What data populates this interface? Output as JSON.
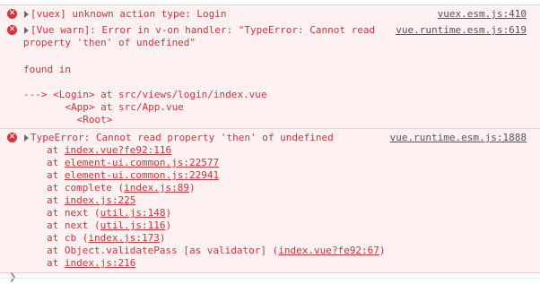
{
  "console": {
    "msg1": {
      "text": "[vuex] unknown action type: Login",
      "source": "vuex.esm.js:410"
    },
    "msg2": {
      "line1": "[Vue warn]: Error in v-on handler: \"TypeError: Cannot read",
      "line2": "property 'then' of undefined\"",
      "found_in": "found in",
      "trace1": "---> <Login> at src/views/login/index.vue",
      "trace2": "       <App> at src/App.vue",
      "trace3": "         <Root>",
      "source": "vue.runtime.esm.js:619"
    },
    "msg3": {
      "text": "TypeError: Cannot read property 'then' of undefined",
      "source": "vue.runtime.esm.js:1888",
      "stack": [
        {
          "prefix": "at ",
          "name": "",
          "link": "index.vue?fe92:116",
          "suffix": ""
        },
        {
          "prefix": "at ",
          "name": "",
          "link": "element-ui.common.js:22577",
          "suffix": ""
        },
        {
          "prefix": "at ",
          "name": "",
          "link": "element-ui.common.js:22941",
          "suffix": ""
        },
        {
          "prefix": "at ",
          "name": "complete (",
          "link": "index.js:89",
          "suffix": ")"
        },
        {
          "prefix": "at ",
          "name": "",
          "link": "index.js:225",
          "suffix": ""
        },
        {
          "prefix": "at ",
          "name": "next (",
          "link": "util.js:148",
          "suffix": ")"
        },
        {
          "prefix": "at ",
          "name": "next (",
          "link": "util.js:116",
          "suffix": ")"
        },
        {
          "prefix": "at ",
          "name": "cb (",
          "link": "index.js:173",
          "suffix": ")"
        },
        {
          "prefix": "at ",
          "name": "Object.validatePass [as validator] (",
          "link": "index.vue?fe92:67",
          "suffix": ")"
        },
        {
          "prefix": "at ",
          "name": "",
          "link": "index.js:216",
          "suffix": ""
        }
      ]
    },
    "prompt_symbol": "❯",
    "error_icon": "x-circle-icon",
    "expand_icon": "triangle-right-icon",
    "colors": {
      "error_text": "#d6333a",
      "error_bg": "#fdf1f1",
      "border": "#f3c9c9"
    }
  }
}
